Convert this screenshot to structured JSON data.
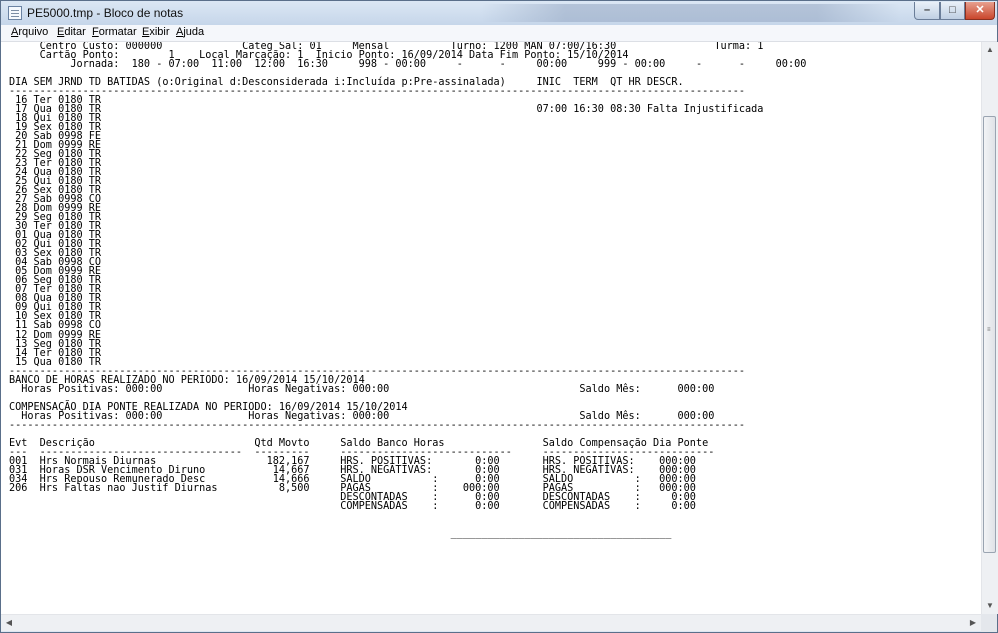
{
  "window": {
    "title": "PE5000.tmp - Bloco de notas",
    "controls": {
      "minimize": "–",
      "maximize": "□",
      "close": "✕"
    }
  },
  "menu": [
    "Arquivo",
    "Editar",
    "Formatar",
    "Exibir",
    "Ajuda"
  ],
  "document_lines": [
    "     Centro Custo: 000000             Categ Sal: 01     Mensal          Turno: 1200 MAN 07:00/16:30                Turma: 1",
    "     Cartão Ponto:        1    Local Marcação: 1  Inicio Ponto: 16/09/2014 Data Fim Ponto: 15/10/2014",
    "          Jornada:  180 - 07:00  11:00  12:00  16:30     998 - 00:00     -      -     00:00     999 - 00:00     -      -     00:00",
    "",
    "DIA SEM JRND TD BATIDAS (o:Original d:Desconsiderada i:Incluída p:Pre-assinalada)     INIC  TERM  QT HR DESCR.",
    "------------------------------------------------------------------------------------------------------------------------",
    " 16 Ter 0180 TR",
    " 17 Qua 0180 TR                                                                       07:00 16:30 08:30 Falta Injustificada",
    " 18 Qui 0180 TR",
    " 19 Sex 0180 TR",
    " 20 Sab 0998 FE",
    " 21 Dom 0999 RE",
    " 22 Seg 0180 TR",
    " 23 Ter 0180 TR",
    " 24 Qua 0180 TR",
    " 25 Qui 0180 TR",
    " 26 Sex 0180 TR",
    " 27 Sab 0998 CO",
    " 28 Dom 0999 RE",
    " 29 Seg 0180 TR",
    " 30 Ter 0180 TR",
    " 01 Qua 0180 TR",
    " 02 Qui 0180 TR",
    " 03 Sex 0180 TR",
    " 04 Sab 0998 CO",
    " 05 Dom 0999 RE",
    " 06 Seg 0180 TR",
    " 07 Ter 0180 TR",
    " 08 Qua 0180 TR",
    " 09 Qui 0180 TR",
    " 10 Sex 0180 TR",
    " 11 Sab 0998 CO",
    " 12 Dom 0999 RE",
    " 13 Seg 0180 TR",
    " 14 Ter 0180 TR",
    " 15 Qua 0180 TR",
    "------------------------------------------------------------------------------------------------------------------------",
    "BANCO DE HORAS REALIZADO NO PERIODO: 16/09/2014 15/10/2014",
    "  Horas Positivas: 000:00              Horas Negativas: 000:00                               Saldo Mês:      000:00",
    "",
    "COMPENSAÇÃO DIA PONTE REALIZADA NO PERIODO: 16/09/2014 15/10/2014",
    "  Horas Positivas: 000:00              Horas Negativas: 000:00                               Saldo Mês:      000:00",
    "------------------------------------------------------------------------------------------------------------------------",
    "",
    "Evt  Descrição                          Qtd Movto     Saldo Banco Horas                Saldo Compensação Dia Ponte",
    "---  ---------------------------------  ---------     ----------------------------     ----------------------------",
    "001  Hrs Normais Diurnas                  182,167     HRS. POSITIVAS:       0:00       HRS. POSITIVAS:    000:00",
    "031  Horas DSR Vencimento Diruno           14,667     HRS. NEGATIVAS:       0:00       HRS. NEGATIVAS:    000:00",
    "034  Hrs Repouso Remunerado Desc           14,666     SALDO          :      0:00       SALDO          :   000:00",
    "206  Hrs Faltas nao Justif Diurnas          8,500     PAGAS          :    000:00       PAGAS          :   000:00",
    "                                                      DESCONTADAS    :      0:00       DESCONTADAS    :     0:00",
    "                                                      COMPENSADAS    :      0:00       COMPENSADAS    :     0:00",
    "",
    "",
    "                                                                        ____________________________________"
  ]
}
